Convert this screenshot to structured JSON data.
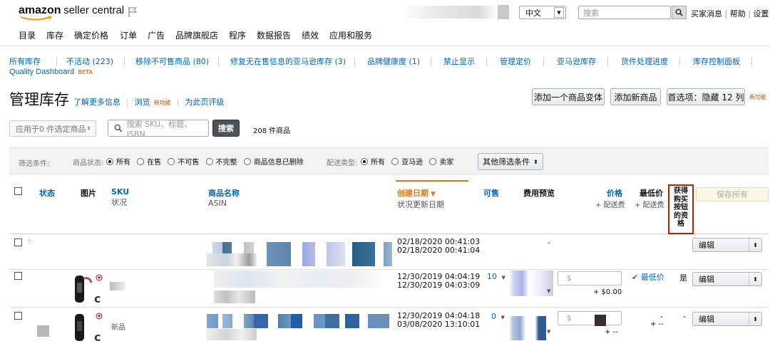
{
  "header": {
    "logo_brand": "amazon",
    "logo_product": "seller central",
    "language": "中文",
    "search_placeholder": "搜索",
    "links": [
      "买家消息",
      "帮助",
      "设置"
    ]
  },
  "nav": {
    "items": [
      "目录",
      "库存",
      "确定价格",
      "订单",
      "广告",
      "品牌旗舰店",
      "程序",
      "数据报告",
      "绩效",
      "应用和服务"
    ]
  },
  "subnav": {
    "items": [
      "所有库存",
      "不活动 (223)",
      "移除不可售商品 (80)",
      "修复无在售信息的亚马逊库存 (3)",
      "品牌健康度 (1)",
      "禁止显示",
      "管理定价",
      "亚马逊库存",
      "货件处理进度",
      "库存控制面板"
    ],
    "quality_dashboard": "Quality Dashboard",
    "beta": "BETA"
  },
  "page": {
    "title": "管理库存",
    "learn_more": "了解更多信息",
    "browse": "浏览",
    "new_tag": "新功能",
    "rate_page": "为此页评级",
    "btn_add_variation": "添加一个商品变体",
    "btn_add_product": "添加新商品",
    "btn_preferences": "首选项：隐藏 12 列",
    "new_tag2": "新功能"
  },
  "toolbar": {
    "bulk_action": "应用于0 件选定商品",
    "search_placeholder": "搜索 SKU、标题、ISBN",
    "search_button": "搜索",
    "count": "208 件商品"
  },
  "filters": {
    "label": "筛选条件:",
    "status_label": "商品状态:",
    "status_options": [
      "所有",
      "在售",
      "不可售",
      "不完整",
      "商品信息已删除"
    ],
    "fulfillment_label": "配送类型:",
    "fulfillment_options": [
      "所有",
      "亚马逊",
      "卖家"
    ],
    "more_filters": "其他筛选条件"
  },
  "table": {
    "headers": {
      "status": "状态",
      "image": "图片",
      "sku": "SKU",
      "sku_sub": "状况",
      "name": "商品名称",
      "name_sub": "ASIN",
      "created": "创建日期",
      "created_sub": "状况更新日期",
      "available": "可售",
      "fee_preview": "费用预览",
      "price": "价格",
      "price_sub": "+ 配送费",
      "lowest": "最低价",
      "lowest_sub": "+ 配送费",
      "buybox": "获得购买按钮的资格",
      "save_all": "保存所有"
    },
    "rows": [
      {
        "created": "02/18/2020 00:41:03",
        "updated": "02/18/2020 00:41:04",
        "available": "",
        "fee": "-",
        "price": "",
        "shipping": "",
        "lowest": "",
        "buybox": "",
        "edit": "编辑"
      },
      {
        "condition": "",
        "created": "12/30/2019 04:04:19",
        "updated": "12/30/2019 04:03:09",
        "available": "10",
        "price_symbol": "$",
        "shipping": "+ $0.00",
        "lowest": "最低价",
        "buybox": "是",
        "edit": "编辑"
      },
      {
        "condition": "新品",
        "created": "12/30/2019 04:04:18",
        "updated": "03/08/2020 13:10:01",
        "available": "0",
        "price_symbol": "$",
        "shipping": "+ --",
        "lowest": "-",
        "lowest_ship": "+ --",
        "buybox": "-",
        "edit": "编辑"
      }
    ]
  },
  "colors": {
    "link": "#0066c0",
    "sort_header": "#e47911",
    "highlight_box": "#b12704",
    "new_tag": "#c45500"
  }
}
